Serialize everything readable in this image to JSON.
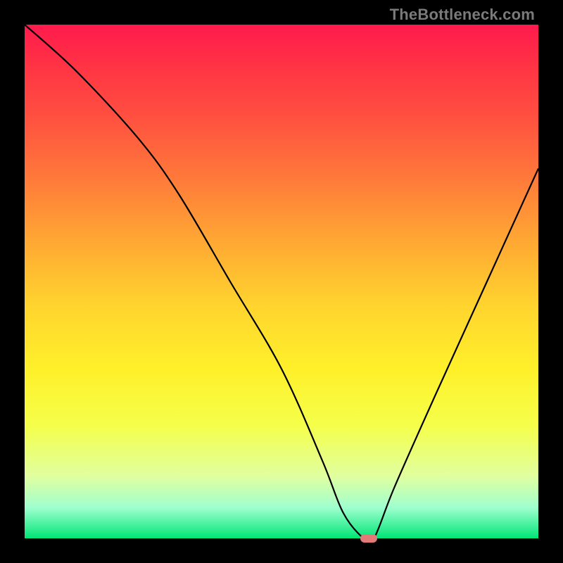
{
  "watermark": "TheBottleneck.com",
  "chart_data": {
    "type": "line",
    "title": "",
    "xlabel": "",
    "ylabel": "",
    "xlim": [
      0,
      100
    ],
    "ylim": [
      0,
      100
    ],
    "x": [
      0,
      10,
      22,
      30,
      40,
      50,
      58,
      62,
      66,
      68,
      72,
      80,
      90,
      100
    ],
    "values": [
      100,
      91,
      78,
      67,
      50,
      33,
      15,
      5,
      0,
      0,
      10,
      28,
      50,
      72
    ],
    "marker": {
      "x": 67,
      "y": 0
    },
    "background_gradient": [
      "#ff1a4d",
      "#ffd52e",
      "#00e676"
    ]
  }
}
